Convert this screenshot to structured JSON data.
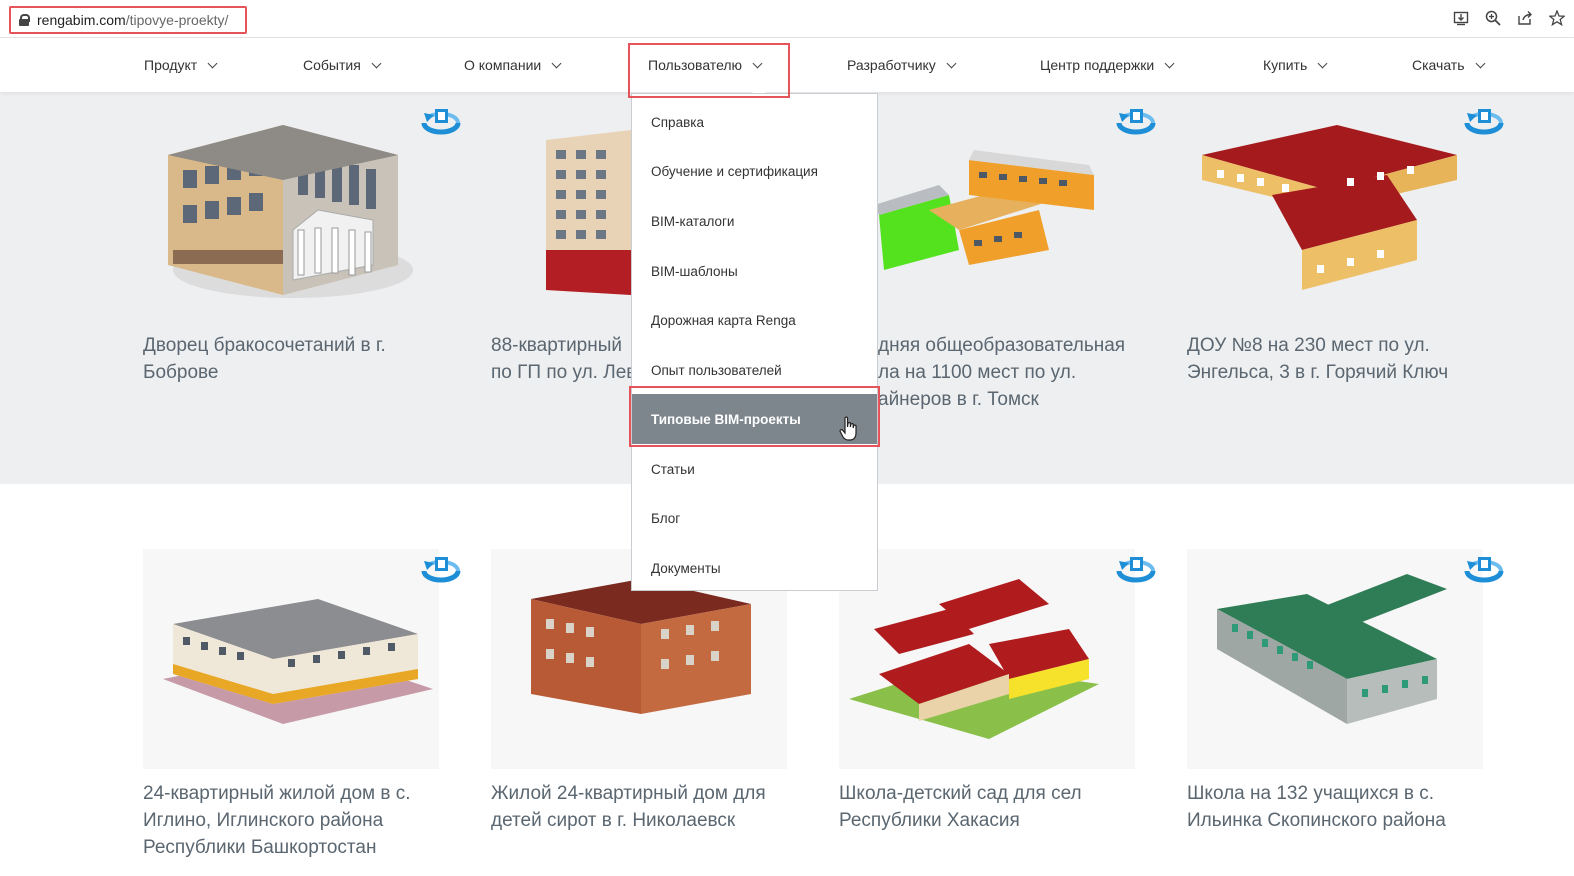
{
  "browser": {
    "url_host": "rengabim.com",
    "url_path": "/tipovye-proekty/",
    "icons": [
      "install-icon",
      "zoom-icon",
      "share-icon",
      "bookmark-star-icon"
    ]
  },
  "nav": {
    "items": [
      {
        "label": "Продукт"
      },
      {
        "label": "События"
      },
      {
        "label": "О компании"
      },
      {
        "label": "Пользователю"
      },
      {
        "label": "Разработчику"
      },
      {
        "label": "Центр поддержки"
      },
      {
        "label": "Купить"
      },
      {
        "label": "Скачать"
      }
    ],
    "active_index": 3
  },
  "dropdown": {
    "items": [
      {
        "label": "Справка"
      },
      {
        "label": "Обучение и сертификация"
      },
      {
        "label": "BIM-каталоги"
      },
      {
        "label": "BIM-шаблоны"
      },
      {
        "label": "Дорожная карта Renga"
      },
      {
        "label": "Опыт пользователей"
      },
      {
        "label": "Типовые BIM-проекты"
      },
      {
        "label": "Статьи"
      },
      {
        "label": "Блог"
      },
      {
        "label": "Документы"
      }
    ],
    "active_index": 6
  },
  "projects": {
    "row1": [
      {
        "title_l1": "Дворец бракосочетаний в г.",
        "title_l2": "Боброве",
        "title_l3": ""
      },
      {
        "title_l1": "88-квартирный",
        "title_l2": "по ГП по ул. Лев",
        "title_l3": ""
      },
      {
        "title_l1": "дняя общеобразовательная",
        "title_l2": "ла на 1100 мест по ул.",
        "title_l3": "айнеров в г. Томск"
      },
      {
        "title_l1": "ДОУ №8 на 230 мест по ул.",
        "title_l2": "Энгельса, 3 в г. Горячий Ключ",
        "title_l3": ""
      }
    ],
    "row2": [
      {
        "title_l1": "24-квартирный жилой дом в с.",
        "title_l2": "Иглино, Иглинского района",
        "title_l3": "Республики Башкортостан"
      },
      {
        "title_l1": "Жилой 24-квартирный дом для",
        "title_l2": "детей сирот в г. Николаевск",
        "title_l3": ""
      },
      {
        "title_l1": "Школа-детский сад для сел",
        "title_l2": "Республики Хакасия",
        "title_l3": ""
      },
      {
        "title_l1": "Школа на 132 учащихся в с.",
        "title_l2": "Ильинка Скопинского района",
        "title_l3": ""
      }
    ]
  },
  "icons": {
    "model_badge": "3d-rotate-icon",
    "cursor": "hand-pointer-icon"
  },
  "colors": {
    "highlight_border": "#e5545a",
    "active_item_bg": "#7d858d",
    "band_bg": "#eeeff1",
    "badge_blue": "#1e8fd6"
  }
}
